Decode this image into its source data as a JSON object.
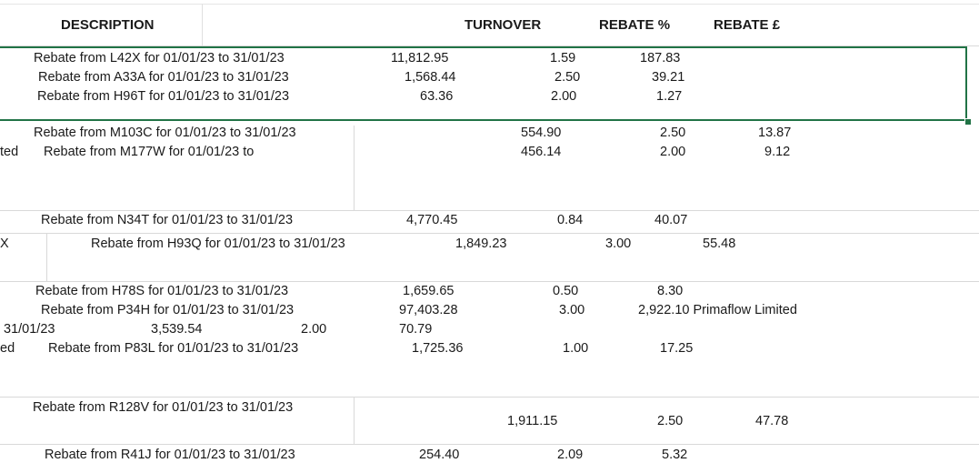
{
  "header": {
    "description": "DESCRIPTION",
    "turnover": "TURNOVER",
    "rebate_pct": "REBATE %",
    "rebate_gbp": "REBATE £"
  },
  "rows": {
    "r1": {
      "desc": "Rebate from L42X for 01/01/23 to 31/01/23",
      "turnover": "11,812.95",
      "pct": "1.59",
      "rebate": "187.83"
    },
    "r2": {
      "desc": "Rebate from A33A for 01/01/23 to 31/01/23",
      "turnover": "1,568.44",
      "pct": "2.50",
      "rebate": "39.21"
    },
    "r3": {
      "desc": "Rebate from H96T for 01/01/23 to 31/01/23",
      "turnover": "63.36",
      "pct": "2.00",
      "rebate": "1.27"
    },
    "r4": {
      "desc": "Rebate from M103C for 01/01/23 to 31/01/23",
      "turnover": "554.90",
      "pct": "2.50",
      "rebate": "13.87"
    },
    "r5": {
      "prefix": "ted",
      "desc": "Rebate from M177W for 01/01/23 to",
      "turnover": "456.14",
      "pct": "2.00",
      "rebate": "9.12"
    },
    "r6": {
      "desc": "Rebate from N34T for 01/01/23 to 31/01/23",
      "turnover": "4,770.45",
      "pct": "0.84",
      "rebate": "40.07"
    },
    "r7": {
      "prefix": "X",
      "desc": "Rebate from H93Q for 01/01/23 to 31/01/23",
      "turnover": "1,849.23",
      "pct": "3.00",
      "rebate": "55.48"
    },
    "r8": {
      "desc": "Rebate from H78S for 01/01/23 to 31/01/23",
      "turnover": "1,659.65",
      "pct": "0.50",
      "rebate": "8.30"
    },
    "r9": {
      "desc": "Rebate from P34H for 01/01/23 to 31/01/23",
      "turnover": "97,403.28",
      "pct": "3.00",
      "rebate": "2,922.10 Primaflow Limited"
    },
    "r10": {
      "date": "31/01/23",
      "turnover": "3,539.54",
      "pct": "2.00",
      "rebate": "70.79"
    },
    "r11": {
      "prefix": "ed",
      "desc": "Rebate from P83L for 01/01/23 to 31/01/23",
      "turnover": "1,725.36",
      "pct": "1.00",
      "rebate": "17.25"
    },
    "r12": {
      "desc": "Rebate from R128V for 01/01/23 to 31/01/23",
      "turnover": "1,911.15",
      "pct": "2.50",
      "rebate": "47.78"
    },
    "r13": {
      "desc": "Rebate from R41J for 01/01/23 to 31/01/23",
      "turnover": "254.40",
      "pct": "2.09",
      "rebate": "5.32"
    }
  }
}
